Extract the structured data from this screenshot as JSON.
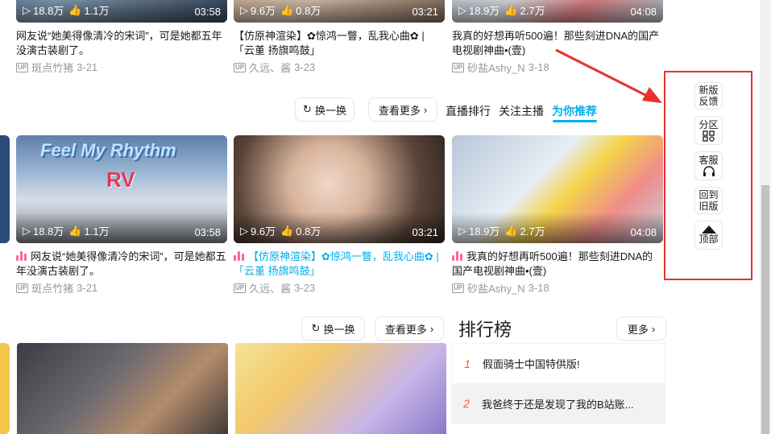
{
  "colors": {
    "accent": "#00aeec",
    "highlight_box": "#e5322d",
    "rank_number": "#f25d2a",
    "hot_icon": "#ff6699"
  },
  "row1": {
    "cards": [
      {
        "views": "18.8万",
        "likes": "1.1万",
        "duration": "03:58",
        "title": "网友说“她美得像清冷的宋词”，可是她都五年没演古装剧了。",
        "uploader": "斑点竹猪",
        "date": "3-21"
      },
      {
        "views": "9.6万",
        "likes": "0.8万",
        "duration": "03:21",
        "title": "【仿原神渲染】✿惊鸿一瞥，乱我心曲✿ |「云堇 扬旗鸣鼓」",
        "uploader": "久远、酱",
        "date": "3-23"
      },
      {
        "views": "18.9万",
        "likes": "2.7万",
        "duration": "04:08",
        "title": "我真的好想再听500遍！那些刻进DNA的国产电视剧神曲•(壹)",
        "uploader": "砂盐Ashy_N",
        "date": "3-18"
      }
    ]
  },
  "toolbar1": {
    "refresh_label": "换一换",
    "more_label": "查看更多",
    "tabs": [
      {
        "label": "直播排行"
      },
      {
        "label": "关注主播"
      },
      {
        "label": "为你推荐"
      }
    ]
  },
  "row2": {
    "cards": [
      {
        "views": "18.8万",
        "likes": "1.1万",
        "duration": "03:58",
        "title": "网友说“她美得像清冷的宋词”，可是她都五年没演古装剧了。",
        "uploader": "斑点竹猪",
        "date": "3-21",
        "thumb_text": "Feel My Rhythm",
        "thumb_sub": "RV"
      },
      {
        "views": "9.6万",
        "likes": "0.8万",
        "duration": "03:21",
        "title": "【仿原神渲染】✿惊鸿一瞥，乱我心曲✿ |「云堇 扬旗鸣鼓」",
        "uploader": "久远、酱",
        "date": "3-23"
      },
      {
        "views": "18.9万",
        "likes": "2.7万",
        "duration": "04:08",
        "title": "我真的好想再听500遍！那些刻进DNA的国产电视剧神曲•(壹)",
        "uploader": "砂盐Ashy_N",
        "date": "3-18"
      }
    ]
  },
  "toolbar2": {
    "refresh_label": "换一换",
    "more_label": "查看更多"
  },
  "ranking": {
    "title": "排行榜",
    "more_label": "更多",
    "items": [
      {
        "rank": "1",
        "title": "假面骑士中国特供版!"
      },
      {
        "rank": "2",
        "title": "我爸终于还是发现了我的B站账..."
      }
    ]
  },
  "fixed_tools": {
    "items": [
      {
        "label": "新版反馈",
        "line1": "新版",
        "line2": "反馈",
        "icon": "none"
      },
      {
        "label": "分区",
        "line1": "分区",
        "line2": "",
        "icon": "grid-search-icon"
      },
      {
        "label": "客服",
        "line1": "客服",
        "line2": "",
        "icon": "headset-icon"
      },
      {
        "label": "回到旧版",
        "line1": "回到",
        "line2": "旧版",
        "icon": "none"
      },
      {
        "label": "顶部",
        "line1": "",
        "line2": "顶部",
        "icon": "triangle-up-icon"
      }
    ]
  }
}
